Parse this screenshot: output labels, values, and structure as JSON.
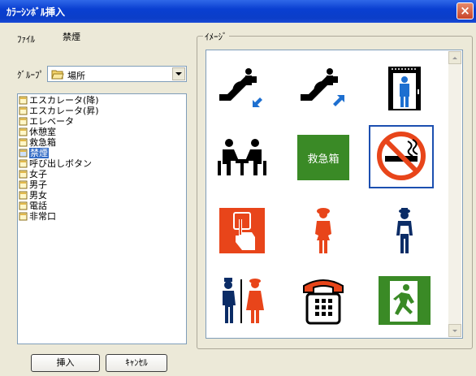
{
  "window": {
    "title": "ｶﾗｰｼﾝﾎﾞﾙ挿入",
    "close_label": "×"
  },
  "file": {
    "label": "ﾌｧｲﾙ",
    "value": "禁煙"
  },
  "group": {
    "label": "ｸﾞﾙｰﾌﾟ",
    "selected": "場所"
  },
  "list": {
    "items": [
      "エスカレータ(降)",
      "エスカレータ(昇)",
      "エレベータ",
      "休憩室",
      "救急箱",
      "禁煙",
      "呼び出しボタン",
      "女子",
      "男子",
      "男女",
      "電話",
      "非常口"
    ],
    "selected_index": 5
  },
  "image_panel": {
    "label": "ｲﾒｰｼﾞ",
    "first_aid_text": "救急箱"
  },
  "buttons": {
    "insert": "挿入",
    "cancel": "ｷｬﾝｾﾙ"
  },
  "colors": {
    "title_bar": "#0a3fd1",
    "selection": "#316ac5",
    "red_symbol": "#e8451a",
    "green_symbol": "#3a8a26"
  },
  "symbols": [
    "escalator-down-icon",
    "escalator-up-icon",
    "elevator-icon",
    "rest-room-icon",
    "first-aid-box-icon",
    "no-smoking-icon",
    "call-button-icon",
    "female-icon",
    "male-icon",
    "male-female-icon",
    "telephone-icon",
    "emergency-exit-icon"
  ]
}
